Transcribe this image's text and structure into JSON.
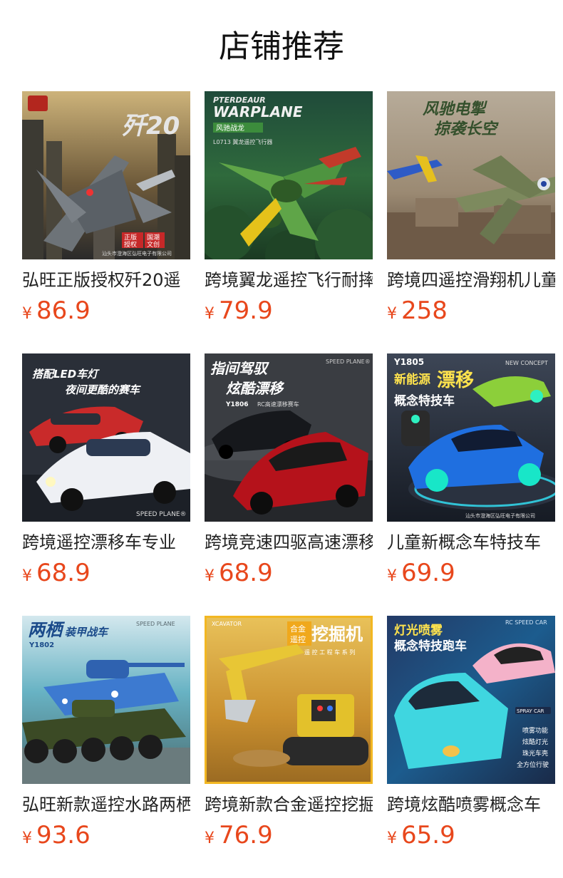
{
  "header": {
    "title": "店铺推荐"
  },
  "currency_symbol": "¥",
  "colors": {
    "price": "#e8471c",
    "title": "#111111",
    "name": "#222222"
  },
  "products": [
    {
      "name": "弘旺正版授权歼20遥",
      "price": "86.9",
      "image": {
        "icon": "fighter-jet-image",
        "texts": [
          "歼20",
          "正版",
          "授权",
          "国潮",
          "文创",
          "汕头市澄海区弘旺电子有限公司"
        ]
      }
    },
    {
      "name": "跨境翼龙遥控飞行耐摔",
      "price": "79.9",
      "image": {
        "icon": "pterosaur-plane-image",
        "texts": [
          "PTERDEAUR",
          "WARPLANE",
          "风驰战龙",
          "L0713 翼龙遥控飞行器"
        ]
      }
    },
    {
      "name": "跨境四遥控滑翔机儿童",
      "price": "258",
      "image": {
        "icon": "glider-plane-image",
        "texts": [
          "风驰电掣",
          "掠袭长空"
        ]
      }
    },
    {
      "name": "跨境遥控漂移车专业",
      "price": "68.9",
      "image": {
        "icon": "drift-car-image",
        "texts": [
          "搭配LED车灯",
          "夜间更酷的赛车",
          "SPEED PLANE®"
        ]
      }
    },
    {
      "name": "跨境竞速四驱高速漂移",
      "price": "68.9",
      "image": {
        "icon": "racing-car-image",
        "texts": [
          "指间驾驭",
          "炫酷漂移",
          "SPEED PLANE®",
          "Y1806",
          "RC高速漂移赛车"
        ]
      }
    },
    {
      "name": "儿童新概念车特技车",
      "price": "69.9",
      "image": {
        "icon": "concept-stunt-car-image",
        "texts": [
          "Y1805",
          "新能源",
          "漂移",
          "概念特技车",
          "NEW CONCEPT",
          "汕头市澄海区弘旺电子有限公司"
        ]
      }
    },
    {
      "name": "弘旺新款遥控水路两栖",
      "price": "93.6",
      "image": {
        "icon": "amphibious-tank-image",
        "texts": [
          "两栖",
          "装甲战车",
          "Y1802",
          "SPEED PLANE"
        ]
      }
    },
    {
      "name": "跨境新款合金遥控挖掘",
      "price": "76.9",
      "image": {
        "icon": "excavator-image",
        "texts": [
          "XCAVATOR",
          "合金",
          "遥控",
          "挖掘机",
          "遥 控 工 程 车 系 列"
        ]
      }
    },
    {
      "name": "跨境炫酷喷雾概念车",
      "price": "65.9",
      "image": {
        "icon": "spray-concept-car-image",
        "texts": [
          "灯光喷雾",
          "概念特技跑车",
          "RC SPEED CAR",
          "SPRAY CAR",
          "喷雾功能",
          "炫酷灯光",
          "珠光车壳",
          "全方位行驶"
        ]
      }
    }
  ]
}
